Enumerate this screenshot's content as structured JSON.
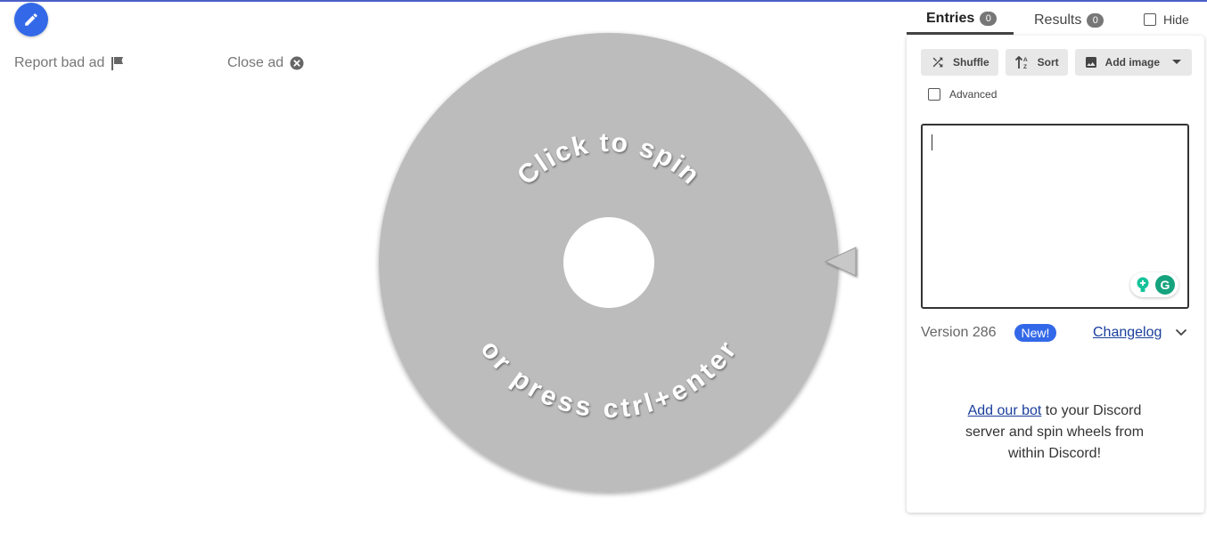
{
  "ads": {
    "report_label": "Report bad ad",
    "close_label": "Close ad"
  },
  "wheel": {
    "top_text": "Click to spin",
    "bottom_text": "or press ctrl+enter",
    "color": "#bcbcbc"
  },
  "tabs": {
    "entries": {
      "label": "Entries",
      "count": "0"
    },
    "results": {
      "label": "Results",
      "count": "0"
    },
    "hide_label": "Hide"
  },
  "toolbar": {
    "shuffle_label": "Shuffle",
    "sort_label": "Sort",
    "add_image_label": "Add image",
    "advanced_label": "Advanced"
  },
  "entries_input": {
    "value": ""
  },
  "version": {
    "text": "Version 286",
    "badge": "New!",
    "changelog_label": "Changelog"
  },
  "discord": {
    "link_text": "Add our bot",
    "rest_text": " to your Discord server and spin wheels from within Discord!"
  },
  "colors": {
    "accent": "#3369e8",
    "link": "#1a3e9c",
    "top_line": "#4a60c8"
  }
}
